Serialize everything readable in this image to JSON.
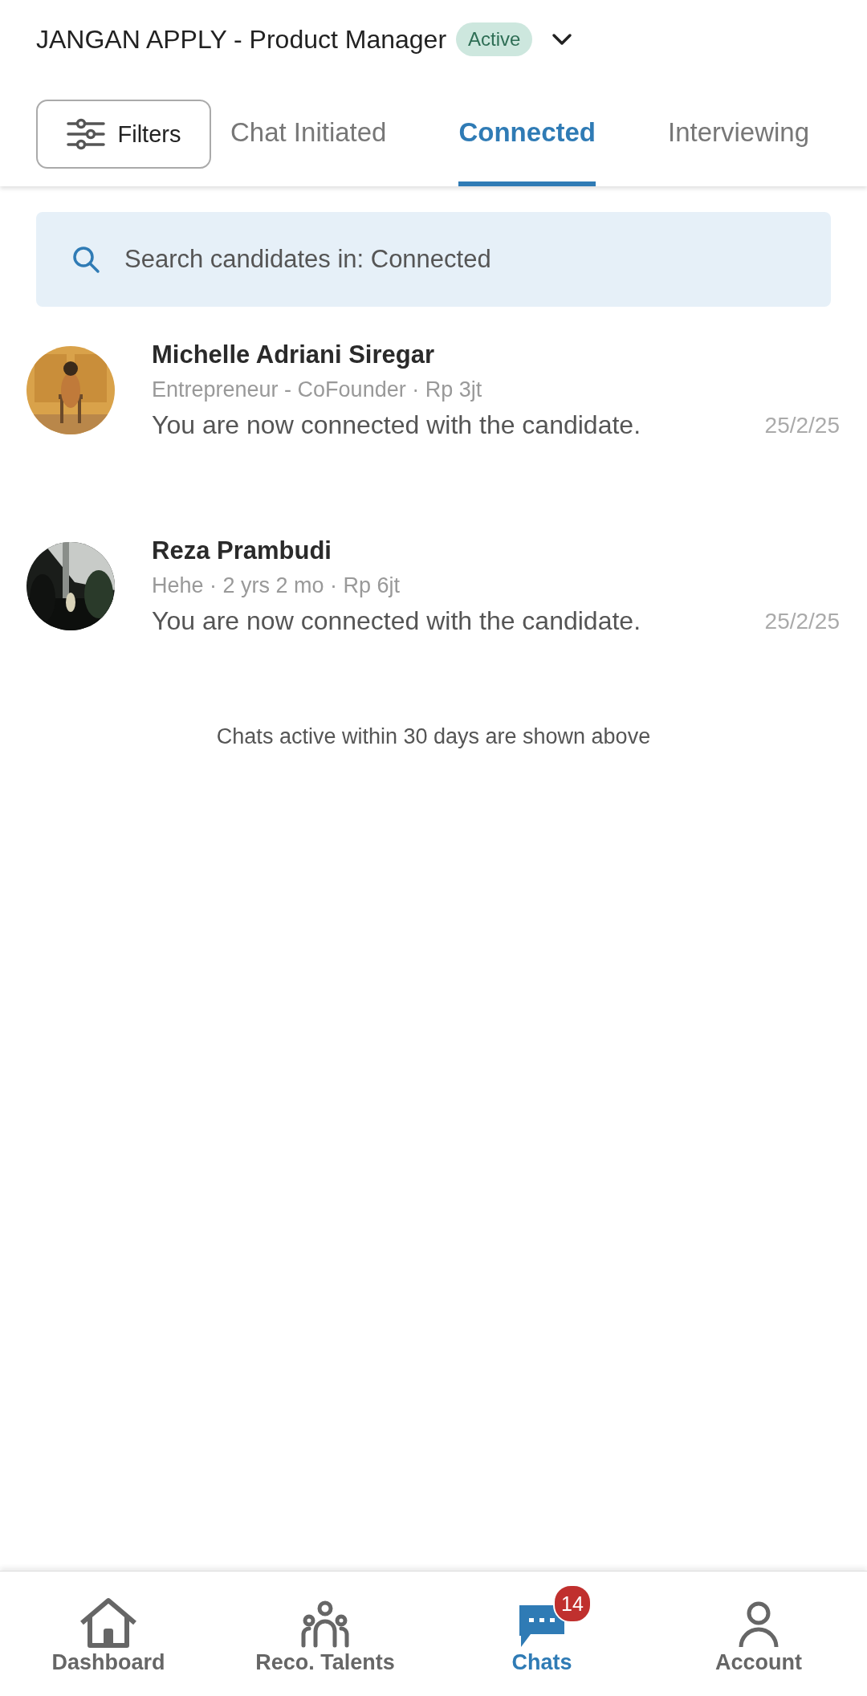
{
  "header": {
    "title": "JANGAN APPLY - Product Manager",
    "status_badge": "Active"
  },
  "filters_button": {
    "label": "Filters"
  },
  "tabs": [
    {
      "label": "Chat Initiated",
      "selected": false
    },
    {
      "label": "Connected",
      "selected": true
    },
    {
      "label": "Interviewing",
      "selected": false
    }
  ],
  "search": {
    "placeholder": "Search candidates in: Connected"
  },
  "chats": [
    {
      "name": "Michelle Adriani Siregar",
      "details": "Entrepreneur - CoFounder · Rp 3jt",
      "message": "You are now connected with the candidate.",
      "date": "25/2/25"
    },
    {
      "name": "Reza Prambudi",
      "details": "Hehe · 2 yrs 2 mo · Rp 6jt",
      "message": "You are now connected with the candidate.",
      "date": "25/2/25"
    }
  ],
  "footer_note": "Chats active within 30 days are shown above",
  "bottom_nav": [
    {
      "kind": "home",
      "label": "Dashboard",
      "selected": false
    },
    {
      "kind": "people",
      "label": "Reco. Talents",
      "selected": false
    },
    {
      "kind": "chat",
      "label": "Chats",
      "selected": true,
      "badge": "14"
    },
    {
      "kind": "person",
      "label": "Account",
      "selected": false
    }
  ]
}
